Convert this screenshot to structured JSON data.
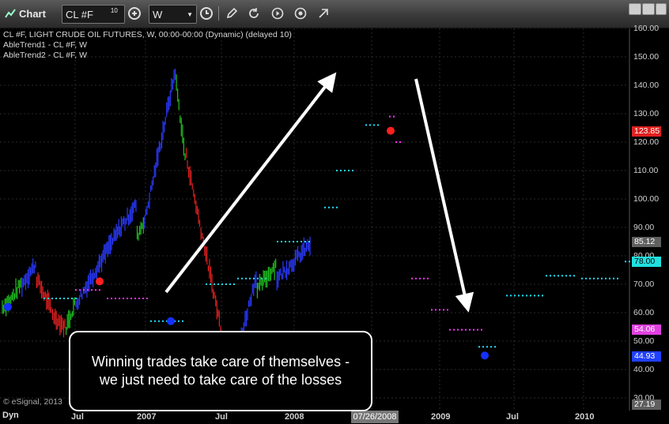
{
  "titlebar": {
    "window_label": "Chart",
    "symbol_value": "CL #F",
    "symbol_superscript": "10",
    "interval_value": "W"
  },
  "legend": {
    "line1": "CL #F, LIGHT CRUDE OIL FUTURES, W, 00:00-00:00 (Dynamic) (delayed 10)",
    "line2": "AbleTrend1 - CL #F, W",
    "line3": "AbleTrend2 - CL #F, W"
  },
  "y_ticks": [
    "160.00",
    "150.00",
    "140.00",
    "130.00",
    "120.00",
    "110.00",
    "100.00",
    "90.00",
    "80.00",
    "70.00",
    "60.00",
    "50.00",
    "40.00",
    "30.00"
  ],
  "price_badges": {
    "b1": "123.85",
    "b2": "85.12",
    "b3": "78.00",
    "b4": "54.06",
    "b5": "44.93",
    "b6": "27.19"
  },
  "badge_colors": {
    "red": "#e02020",
    "gray": "#606060",
    "cyan": "#20e0e0",
    "magenta": "#e040e0",
    "blue": "#2040ff"
  },
  "x_ticks": [
    "Jul",
    "2007",
    "Jul",
    "2008",
    "07/26/2008",
    "2009",
    "Jul",
    "2010"
  ],
  "callout": {
    "line1": "Winning trades take care of themselves -",
    "line2": "we just need to take care of the losses"
  },
  "footer": {
    "copyright": "© eSignal, 2013",
    "mode": "Dyn"
  },
  "chart_data": {
    "type": "bar",
    "title": "CL #F, LIGHT CRUDE OIL FUTURES, W",
    "y_axis_range": [
      30,
      160
    ],
    "colors": {
      "up_trend": "#2a3aff",
      "down_trend": "#e02020",
      "neutral": "#20c020",
      "support": "#20e0ff",
      "resistance": "#ff30ff"
    },
    "segments": [
      {
        "trend": "up",
        "color": "neutral",
        "from": 62,
        "to": 64,
        "n": 6
      },
      {
        "trend": "up",
        "color": "neutral",
        "from": 64,
        "to": 70,
        "n": 10
      },
      {
        "trend": "up",
        "color": "up",
        "from": 70,
        "to": 77,
        "n": 12
      },
      {
        "trend": "down",
        "color": "down",
        "from": 72,
        "to": 58,
        "n": 16
      },
      {
        "trend": "down",
        "color": "down",
        "from": 58,
        "to": 55,
        "n": 8
      },
      {
        "trend": "up",
        "color": "neutral",
        "from": 55,
        "to": 63,
        "n": 8
      },
      {
        "trend": "up",
        "color": "up",
        "from": 63,
        "to": 92,
        "n": 40
      },
      {
        "trend": "up",
        "color": "up",
        "from": 92,
        "to": 98,
        "n": 10
      },
      {
        "trend": "up",
        "color": "neutral",
        "from": 87,
        "to": 92,
        "n": 6
      },
      {
        "trend": "up",
        "color": "up",
        "from": 92,
        "to": 145,
        "n": 26
      },
      {
        "trend": "down",
        "color": "neutral",
        "from": 140,
        "to": 115,
        "n": 8
      },
      {
        "trend": "down",
        "color": "down",
        "from": 115,
        "to": 36,
        "n": 38
      },
      {
        "trend": "down",
        "color": "neutral",
        "from": 40,
        "to": 50,
        "n": 6
      },
      {
        "trend": "up",
        "color": "up",
        "from": 50,
        "to": 73,
        "n": 14
      },
      {
        "trend": "up",
        "color": "neutral",
        "from": 68,
        "to": 77,
        "n": 16
      },
      {
        "trend": "up",
        "color": "up",
        "from": 72,
        "to": 84,
        "n": 28
      }
    ],
    "signals": [
      {
        "type": "buy",
        "color": "blue",
        "x": 10,
        "y": 62
      },
      {
        "type": "sell",
        "color": "red",
        "x": 126,
        "y": 71
      },
      {
        "type": "buy",
        "color": "blue",
        "x": 216,
        "y": 57
      },
      {
        "type": "sell",
        "color": "red",
        "x": 494,
        "y": 124
      },
      {
        "type": "buy",
        "color": "blue",
        "x": 613,
        "y": 44.93
      }
    ]
  }
}
